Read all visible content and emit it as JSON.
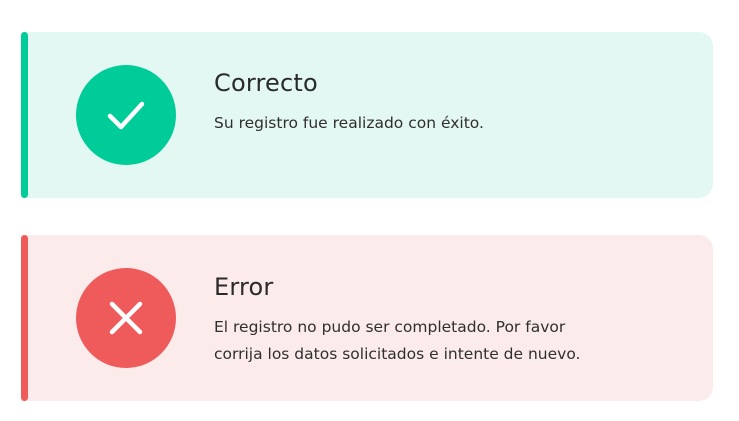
{
  "colors": {
    "success_accent": "#00cc99",
    "success_background": "#e3f8f2",
    "error_accent": "#ef5a5a",
    "error_background": "#fcebeb",
    "icon_glyph": "#ffffff",
    "text": "#2a2a2a"
  },
  "alerts": {
    "success": {
      "icon": "checkmark-icon",
      "title": "Correcto",
      "message": "Su registro fue realizado con éxito."
    },
    "error": {
      "icon": "close-x-icon",
      "title": "Error",
      "message_line_1": "El registro no pudo ser completado. Por favor",
      "message_line_2": "corrija los datos solicitados e intente de nuevo."
    }
  }
}
